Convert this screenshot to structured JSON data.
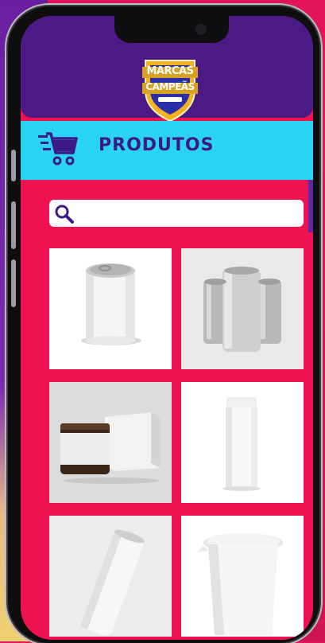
{
  "app": {
    "logo_line1": "MARCAS",
    "logo_line2": "CAMPEÃS",
    "title": "PRODUTOS"
  },
  "search": {
    "placeholder": "",
    "value": ""
  },
  "products": [
    {
      "name": "tin-can"
    },
    {
      "name": "aluminum-cans"
    },
    {
      "name": "amber-jar-box"
    },
    {
      "name": "white-bottle"
    },
    {
      "name": "tilted-slim-can"
    },
    {
      "name": "white-cup"
    }
  ],
  "colors": {
    "header": "#4b1a86",
    "titlebar": "#2ad3f3",
    "background": "#ef1250",
    "title_text": "#3b1a85"
  }
}
